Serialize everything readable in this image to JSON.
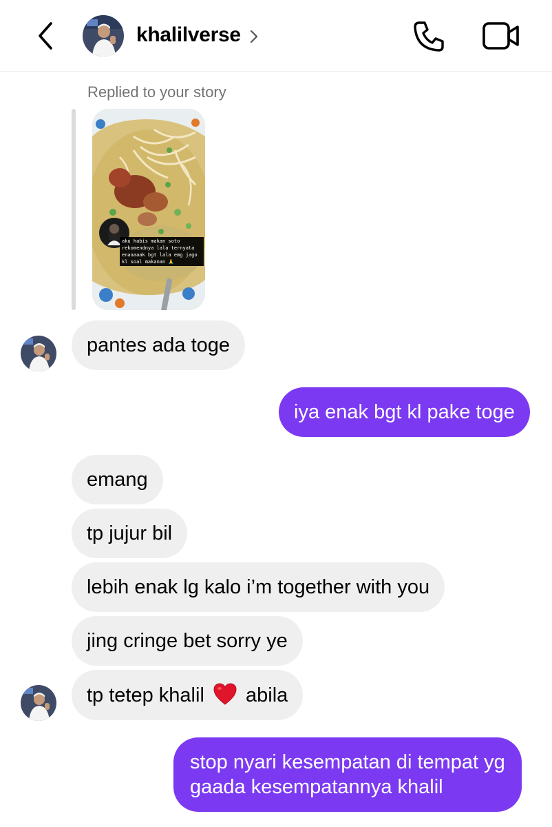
{
  "header": {
    "username": "khalilverse"
  },
  "reply": {
    "label": "Replied to your story",
    "story_caption": "aku habis makan soto rekomendnya lala ternyata enaaaaak bgt lala emg jago kl soal makanan 🙏"
  },
  "messages": [
    {
      "from": "them",
      "text": "pantes ada toge"
    },
    {
      "from": "me",
      "text": "iya enak bgt kl pake toge"
    },
    {
      "from": "them",
      "text": "emang"
    },
    {
      "from": "them",
      "text": "tp jujur bil"
    },
    {
      "from": "them",
      "text": "lebih enak lg kalo i’m together with you"
    },
    {
      "from": "them",
      "text": "jing cringe bet sorry ye"
    },
    {
      "from": "them",
      "text_before": "tp tetep khalil",
      "text_after": "abila"
    },
    {
      "from": "me",
      "line1": "stop nyari kesempatan di tempat yg",
      "line2": "gaada kesempatannya khalil"
    }
  ],
  "icons": {
    "back": "chevron-left-icon",
    "user_chevron": "chevron-right-icon",
    "call": "phone-icon",
    "video": "video-camera-icon",
    "heart": "red-heart-emoji"
  },
  "colors": {
    "outgoing_bubble": "#7b3af2",
    "incoming_bubble": "#efefef",
    "muted_text": "#737373",
    "heart": "#e0142a"
  }
}
